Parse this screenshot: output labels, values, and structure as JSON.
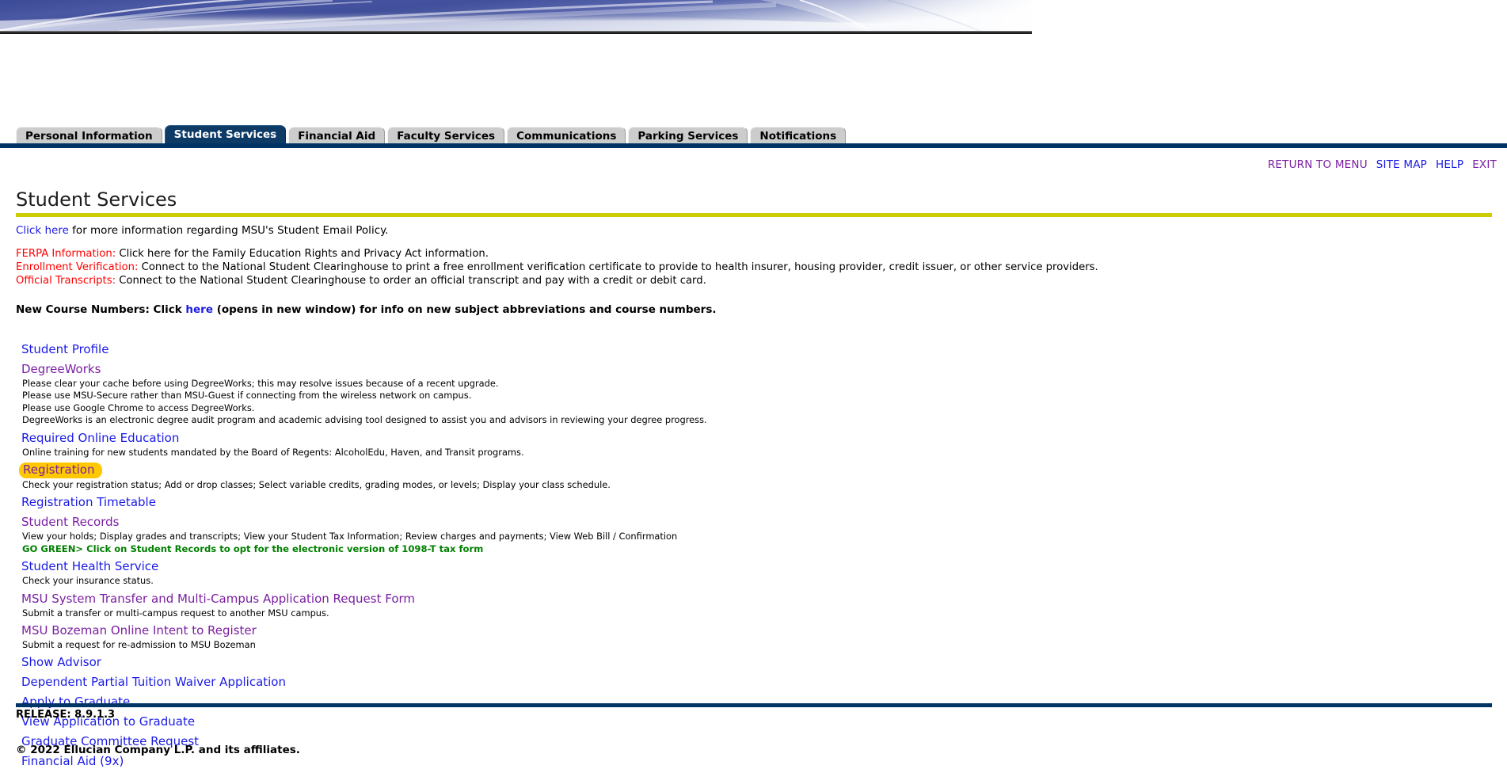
{
  "banner": {
    "alt": "msu-banner-swoosh-image"
  },
  "tabs": [
    {
      "label": "Personal Information",
      "active": false
    },
    {
      "label": "Student Services",
      "active": true
    },
    {
      "label": "Financial Aid",
      "active": false
    },
    {
      "label": "Faculty Services",
      "active": false
    },
    {
      "label": "Communications",
      "active": false
    },
    {
      "label": "Parking Services",
      "active": false
    },
    {
      "label": "Notifications",
      "active": false
    }
  ],
  "utility_links": [
    {
      "label": "RETURN TO MENU",
      "state": "visited"
    },
    {
      "label": "SITE MAP",
      "state": "link"
    },
    {
      "label": "HELP",
      "state": "link"
    },
    {
      "label": "EXIT",
      "state": "visited"
    }
  ],
  "page": {
    "title": "Student Services"
  },
  "notice": {
    "link_text": "Click here",
    "rest_text": " for more information regarding MSU's Student Email Policy."
  },
  "info_rows": [
    {
      "label": "FERPA Information:",
      "text": " Click here for the Family Education Rights and Privacy Act information."
    },
    {
      "label": "Enrollment Verification:",
      "text": " Connect to the National Student Clearinghouse to print a free enrollment verification certificate to provide to health insurer, housing provider, credit issuer, or other service providers."
    },
    {
      "label": "Official Transcripts:",
      "text": " Connect to the National Student Clearinghouse to order an official transcript and pay with a credit or debit card."
    }
  ],
  "course_note": {
    "before": "New Course Numbers: Click ",
    "link_text": "here",
    "after": " (opens in new window) for info on new subject abbreviations and course numbers."
  },
  "services": [
    {
      "label": "Student Profile",
      "state": "blue",
      "descriptions": []
    },
    {
      "label": "DegreeWorks",
      "state": "visited",
      "descriptions": [
        {
          "text": "Please clear your cache before using DegreeWorks; this may resolve issues because of a recent upgrade.",
          "style": "normal"
        },
        {
          "text": "Please use MSU-Secure rather than MSU-Guest if connecting from the wireless network on campus.",
          "style": "normal"
        },
        {
          "text": "Please use Google Chrome to access DegreeWorks.",
          "style": "normal"
        },
        {
          "text": "DegreeWorks is an electronic degree audit program and academic advising tool designed to assist you and advisors in reviewing your degree progress.",
          "style": "normal"
        }
      ]
    },
    {
      "label": "Required Online Education",
      "state": "blue",
      "descriptions": [
        {
          "text": "Online training for new students mandated by the Board of Regents: AlcoholEdu, Haven, and Transit programs.",
          "style": "normal"
        }
      ]
    },
    {
      "label": "Registration",
      "state": "highlight",
      "descriptions": [
        {
          "text": "Check your registration status; Add or drop classes; Select variable credits, grading modes, or levels; Display your class schedule.",
          "style": "normal"
        }
      ]
    },
    {
      "label": "Registration Timetable",
      "state": "blue",
      "descriptions": []
    },
    {
      "label": "Student Records",
      "state": "visited",
      "descriptions": [
        {
          "text": "View your holds; Display grades and transcripts; View your Student Tax Information; Review charges and payments; View Web Bill / Confirmation",
          "style": "normal"
        },
        {
          "text": "GO GREEN> Click on Student Records to opt for the electronic version of 1098-T tax form",
          "style": "green"
        }
      ]
    },
    {
      "label": "Student Health Service",
      "state": "blue",
      "descriptions": [
        {
          "text": "Check your insurance status.",
          "style": "normal"
        }
      ]
    },
    {
      "label": "MSU System Transfer and Multi-Campus Application Request Form",
      "state": "visited",
      "descriptions": [
        {
          "text": "Submit a transfer or multi-campus request to another MSU campus.",
          "style": "normal"
        }
      ]
    },
    {
      "label": "MSU Bozeman Online Intent to Register",
      "state": "visited",
      "descriptions": [
        {
          "text": "Submit a request for re-admission to MSU Bozeman",
          "style": "normal"
        }
      ]
    },
    {
      "label": "Show Advisor",
      "state": "blue",
      "descriptions": []
    },
    {
      "label": "Dependent Partial Tuition Waiver Application",
      "state": "blue",
      "descriptions": []
    },
    {
      "label": "Apply to Graduate",
      "state": "blue",
      "descriptions": []
    },
    {
      "label": "View Application to Graduate",
      "state": "blue",
      "descriptions": []
    },
    {
      "label": "Graduate Committee Request",
      "state": "blue",
      "descriptions": []
    },
    {
      "label": "Financial Aid (9x)",
      "state": "blue",
      "descriptions": []
    }
  ],
  "footer": {
    "release": "RELEASE: 8.9.1.3",
    "copyright": "© 2022 Ellucian Company L.P. and its affiliates."
  },
  "colors": {
    "navy": "#003366",
    "yellow_rule": "#cccc00",
    "link_blue": "#1a1ae6",
    "link_visited": "#7b1fa2",
    "alert_red": "#ff0000",
    "green": "#008000",
    "highlight_gold": "#ffc800",
    "tab_inactive": "#cccccc"
  }
}
